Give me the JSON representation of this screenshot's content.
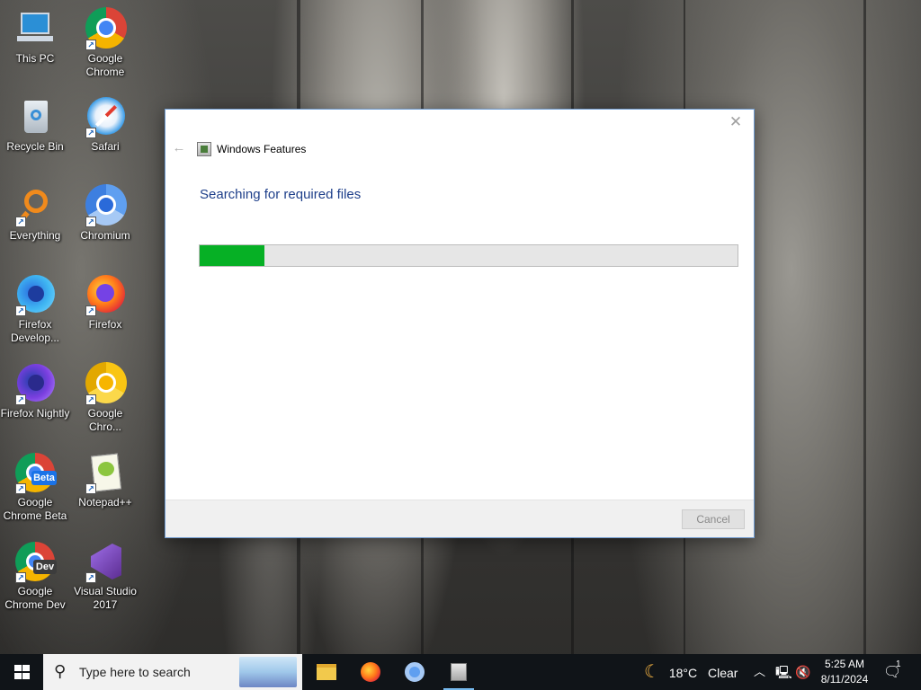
{
  "desktop": {
    "icons": [
      {
        "label": "This PC",
        "icon": "this-pc-icon"
      },
      {
        "label": "Google Chrome",
        "icon": "chrome-icon"
      },
      {
        "label": "Recycle Bin",
        "icon": "recycle-bin-icon"
      },
      {
        "label": "Safari",
        "icon": "safari-icon"
      },
      {
        "label": "Everything",
        "icon": "everything-icon"
      },
      {
        "label": "Chromium",
        "icon": "chromium-icon"
      },
      {
        "label": "Firefox Develop...",
        "icon": "firefox-developer-icon"
      },
      {
        "label": "Firefox",
        "icon": "firefox-icon"
      },
      {
        "label": "Firefox Nightly",
        "icon": "firefox-nightly-icon"
      },
      {
        "label": "Google Chro...",
        "icon": "chrome-canary-icon"
      },
      {
        "label": "Google Chrome Beta",
        "icon": "chrome-beta-icon",
        "badge": "Beta"
      },
      {
        "label": "Notepad++",
        "icon": "notepad-plus-plus-icon"
      },
      {
        "label": "Google Chrome Dev",
        "icon": "chrome-dev-icon",
        "badge": "Dev"
      },
      {
        "label": "Visual Studio 2017",
        "icon": "visual-studio-icon"
      }
    ]
  },
  "dialog": {
    "title": "Windows Features",
    "heading": "Searching for required files",
    "progress": 0.12,
    "progress_color": "#06b025",
    "cancel_label": "Cancel",
    "close_glyph": "✕",
    "back_glyph": "←"
  },
  "taskbar": {
    "search_placeholder": "Type here to search",
    "apps": [
      "file-explorer-icon",
      "firefox-icon",
      "chromium-icon",
      "windows-features-icon"
    ],
    "weather_temp": "18°C",
    "weather_cond": "Clear",
    "time": "5:25 AM",
    "date": "8/11/2024",
    "notification_count": "1"
  }
}
